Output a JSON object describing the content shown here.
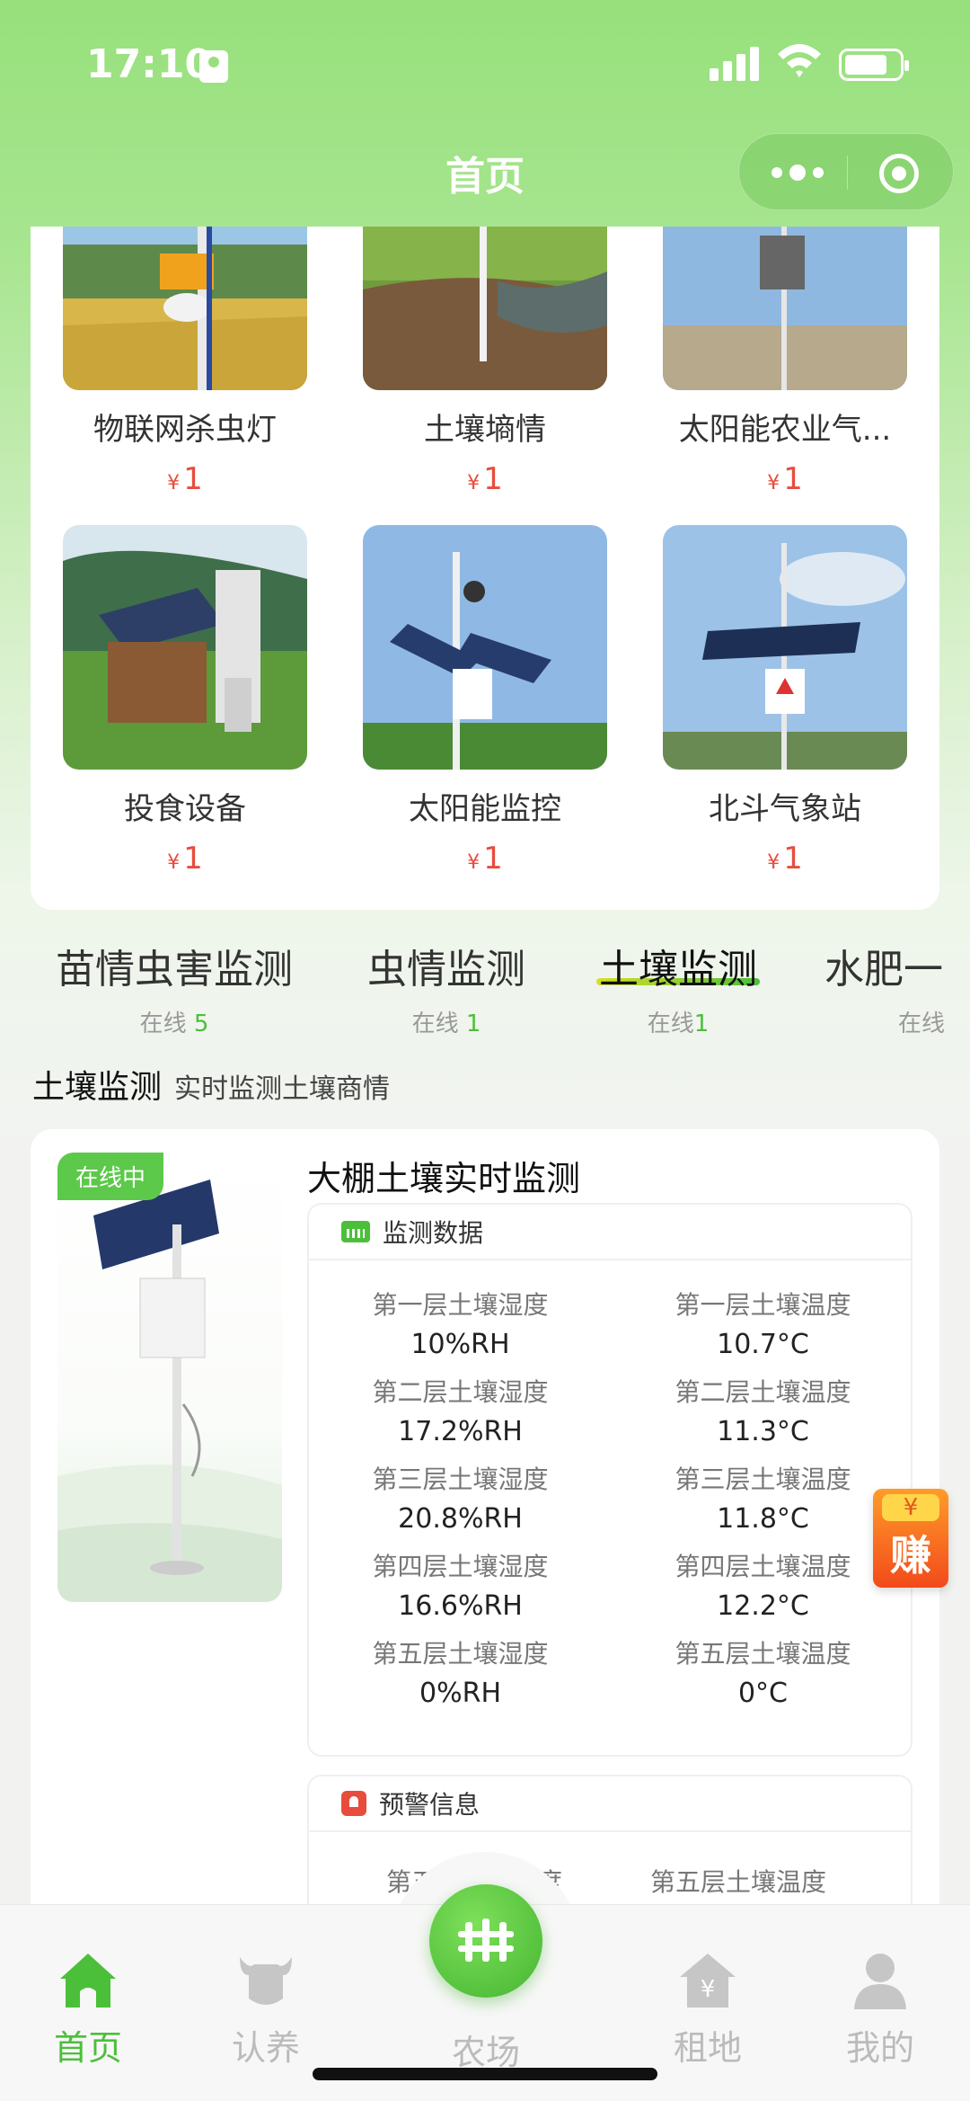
{
  "status_bar": {
    "time": "17:10"
  },
  "header": {
    "title": "首页"
  },
  "products": [
    {
      "name": "物联网杀虫灯",
      "price_symbol": "¥",
      "price": "1",
      "image": "insect-killer-lamp"
    },
    {
      "name": "土壤墒情",
      "price_symbol": "¥",
      "price": "1",
      "image": "soil-moisture-station"
    },
    {
      "name": "太阳能农业气...",
      "price_symbol": "¥",
      "price": "1",
      "image": "solar-weather-box"
    },
    {
      "name": "投食设备",
      "price_symbol": "¥",
      "price": "1",
      "image": "feeding-equipment"
    },
    {
      "name": "太阳能监控",
      "price_symbol": "¥",
      "price": "1",
      "image": "solar-camera"
    },
    {
      "name": "北斗气象站",
      "price_symbol": "¥",
      "price": "1",
      "image": "beidou-weather-station"
    }
  ],
  "tabs": [
    {
      "label": "苗情虫害监测",
      "online_label": "在线",
      "online_count": "5"
    },
    {
      "label": "虫情监测",
      "online_label": "在线",
      "online_count": "1"
    },
    {
      "label": "土壤监测",
      "online_label": "在线",
      "online_count": "1",
      "active": true
    },
    {
      "label": "水肥一",
      "online_label": "在线",
      "online_count": ""
    }
  ],
  "section": {
    "title": "土壤监测",
    "subtitle": "实时监测土壤商情"
  },
  "device": {
    "status_badge": "在线中",
    "name": "大棚土壤实时监测",
    "monitor_title": "监测数据",
    "readings": [
      {
        "label": "第一层土壤湿度",
        "value": "10%RH"
      },
      {
        "label": "第一层土壤温度",
        "value": "10.7°C"
      },
      {
        "label": "第二层土壤湿度",
        "value": "17.2%RH"
      },
      {
        "label": "第二层土壤温度",
        "value": "11.3°C"
      },
      {
        "label": "第三层土壤湿度",
        "value": "20.8%RH"
      },
      {
        "label": "第三层土壤温度",
        "value": "11.8°C"
      },
      {
        "label": "第四层土壤湿度",
        "value": "16.6%RH"
      },
      {
        "label": "第四层土壤温度",
        "value": "12.2°C"
      },
      {
        "label": "第五层土壤湿度",
        "value": "0%RH"
      },
      {
        "label": "第五层土壤温度",
        "value": "0°C"
      }
    ],
    "warning_title": "预警信息",
    "warning_items": [
      "第五层土壤湿度",
      "第五层土壤温度"
    ]
  },
  "earn_button": {
    "yen": "¥",
    "label": "赚"
  },
  "bottom_nav": [
    {
      "label": "首页",
      "icon": "home-icon",
      "active": true
    },
    {
      "label": "认养",
      "icon": "cow-icon"
    },
    {
      "label": "农场",
      "icon": "fence-icon"
    },
    {
      "label": "租地",
      "icon": "land-rent-icon"
    },
    {
      "label": "我的",
      "icon": "user-icon"
    }
  ],
  "colors": {
    "brand_green": "#97e07c",
    "accent_green": "#4bbf3a",
    "price_red": "#e84c3d"
  }
}
